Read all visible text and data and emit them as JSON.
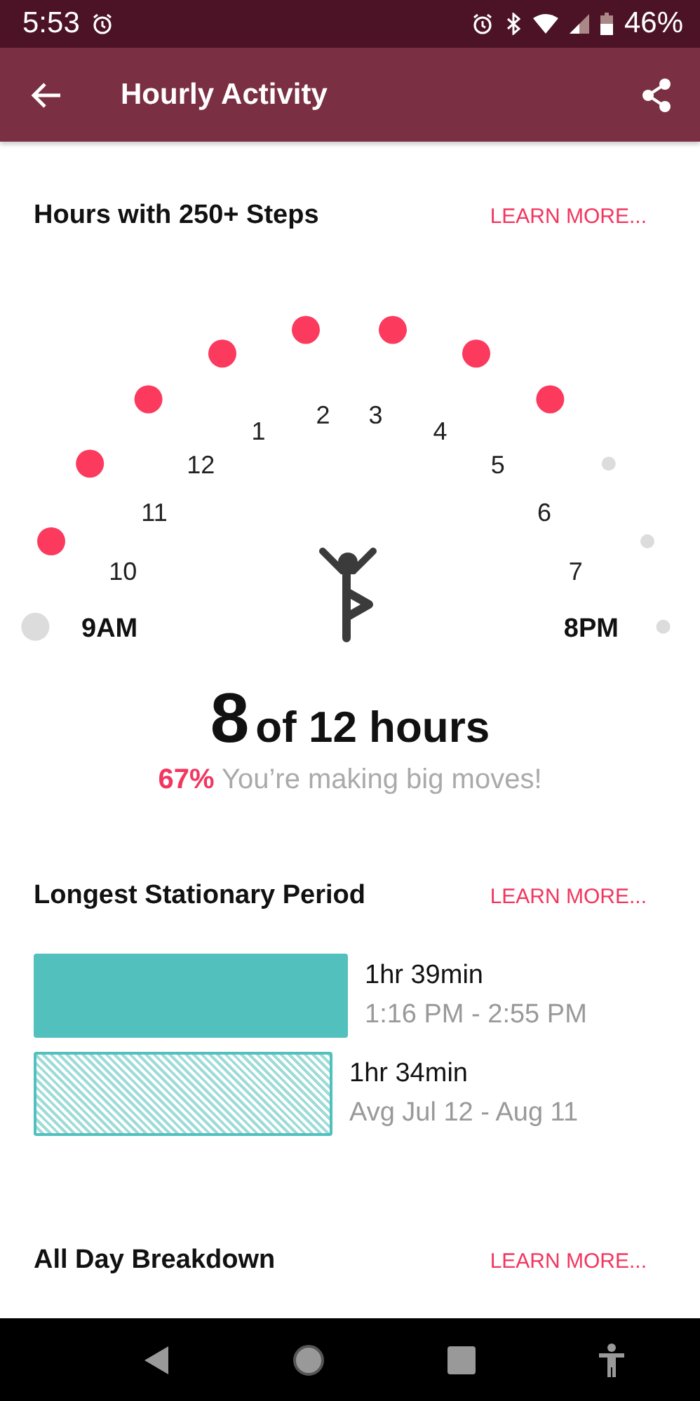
{
  "status_bar": {
    "time": "5:53",
    "battery": "46%"
  },
  "app_bar": {
    "title": "Hourly Activity"
  },
  "hourly": {
    "title": "Hours with 250+ Steps",
    "link": "LEARN MORE...",
    "hours": [
      {
        "label": "9AM",
        "met": false,
        "upcoming": false
      },
      {
        "label": "10",
        "met": true
      },
      {
        "label": "11",
        "met": true
      },
      {
        "label": "12",
        "met": true
      },
      {
        "label": "1",
        "met": true
      },
      {
        "label": "2",
        "met": true
      },
      {
        "label": "3",
        "met": true
      },
      {
        "label": "4",
        "met": true
      },
      {
        "label": "5",
        "met": true
      },
      {
        "label": "6",
        "met": false,
        "upcoming": true
      },
      {
        "label": "7",
        "met": false,
        "upcoming": true
      },
      {
        "label": "8PM",
        "met": false,
        "upcoming": true
      }
    ],
    "count": "8",
    "count_suffix": "of 12 hours",
    "percent": "67%",
    "message": "You’re making big moves!"
  },
  "stationary": {
    "title": "Longest Stationary Period",
    "link": "LEARN MORE...",
    "bars": [
      {
        "kind": "solid",
        "duration": "1hr 39min",
        "detail": "1:16 PM - 2:55 PM"
      },
      {
        "kind": "hatched",
        "duration": "1hr 34min",
        "detail": "Avg Jul 12 - Aug 11"
      }
    ]
  },
  "breakdown": {
    "title": "All Day Breakdown",
    "link": "LEARN MORE..."
  }
}
